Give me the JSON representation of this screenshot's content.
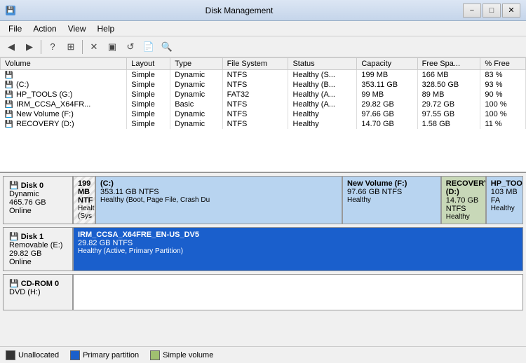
{
  "window": {
    "title": "Disk Management",
    "icon": "💾"
  },
  "title_controls": {
    "minimize": "−",
    "maximize": "□",
    "close": "✕"
  },
  "menu": {
    "items": [
      "File",
      "Action",
      "View",
      "Help"
    ]
  },
  "toolbar": {
    "buttons": [
      "←",
      "→",
      "▣",
      "?",
      "⊡",
      "✕",
      "⬛",
      "⬛",
      "⬛",
      "⬛",
      "⬛"
    ]
  },
  "table": {
    "headers": [
      "Volume",
      "Layout",
      "Type",
      "File System",
      "Status",
      "Capacity",
      "Free Spa...",
      "% Free"
    ],
    "rows": [
      {
        "volume": "",
        "layout": "Simple",
        "type": "Dynamic",
        "fs": "NTFS",
        "status": "Healthy (S...",
        "capacity": "199 MB",
        "free": "166 MB",
        "pct": "83 %"
      },
      {
        "volume": "(C:)",
        "layout": "Simple",
        "type": "Dynamic",
        "fs": "NTFS",
        "status": "Healthy (B...",
        "capacity": "353.11 GB",
        "free": "328.50 GB",
        "pct": "93 %"
      },
      {
        "volume": "HP_TOOLS (G:)",
        "layout": "Simple",
        "type": "Dynamic",
        "fs": "FAT32",
        "status": "Healthy (A...",
        "capacity": "99 MB",
        "free": "89 MB",
        "pct": "90 %"
      },
      {
        "volume": "IRM_CCSA_X64FR...",
        "layout": "Simple",
        "type": "Basic",
        "fs": "NTFS",
        "status": "Healthy (A...",
        "capacity": "29.82 GB",
        "free": "29.72 GB",
        "pct": "100 %"
      },
      {
        "volume": "New Volume (F:)",
        "layout": "Simple",
        "type": "Dynamic",
        "fs": "NTFS",
        "status": "Healthy",
        "capacity": "97.66 GB",
        "free": "97.55 GB",
        "pct": "100 %"
      },
      {
        "volume": "RECOVERY (D:)",
        "layout": "Simple",
        "type": "Dynamic",
        "fs": "NTFS",
        "status": "Healthy",
        "capacity": "14.70 GB",
        "free": "1.58 GB",
        "pct": "11 %"
      }
    ]
  },
  "disks": [
    {
      "name": "Disk 0",
      "type": "Dynamic",
      "size": "465.76 GB",
      "status": "Online",
      "partitions": [
        {
          "label": "199 MB NTF",
          "detail1": "Healthy (Sys",
          "width": "5%",
          "type": "striped"
        },
        {
          "label": "(C:)",
          "sublabel": "353.11 GB NTFS",
          "detail1": "Healthy (Boot, Page File, Crash Du",
          "width": "55%",
          "type": "primary"
        },
        {
          "label": "New Volume  (F:)",
          "sublabel": "97.66 GB NTFS",
          "detail1": "Healthy",
          "width": "22%",
          "type": "primary"
        },
        {
          "label": "RECOVERY (D:)",
          "sublabel": "14.70 GB NTFS",
          "detail1": "Healthy",
          "width": "10%",
          "type": "recovery"
        },
        {
          "label": "HP_TOOLS",
          "sublabel": "103 MB FA",
          "detail1": "Healthy",
          "width": "8%",
          "type": "primary"
        }
      ]
    },
    {
      "name": "Disk 1",
      "type": "Removable (E:)",
      "size": "29.82 GB",
      "status": "Online",
      "partitions": [
        {
          "label": "IRM_CCSA_X64FRE_EN-US_DV5",
          "sublabel": "29.82 GB NTFS",
          "detail1": "Healthy (Active, Primary Partition)",
          "width": "100%",
          "type": "selected-partition"
        }
      ]
    },
    {
      "name": "CD-ROM 0",
      "type": "DVD (H:)",
      "size": "",
      "status": "",
      "partitions": []
    }
  ],
  "legend": {
    "items": [
      {
        "label": "Unallocated",
        "color": "unalloc"
      },
      {
        "label": "Primary partition",
        "color": "primary"
      },
      {
        "label": "Simple volume",
        "color": "simple"
      }
    ]
  }
}
